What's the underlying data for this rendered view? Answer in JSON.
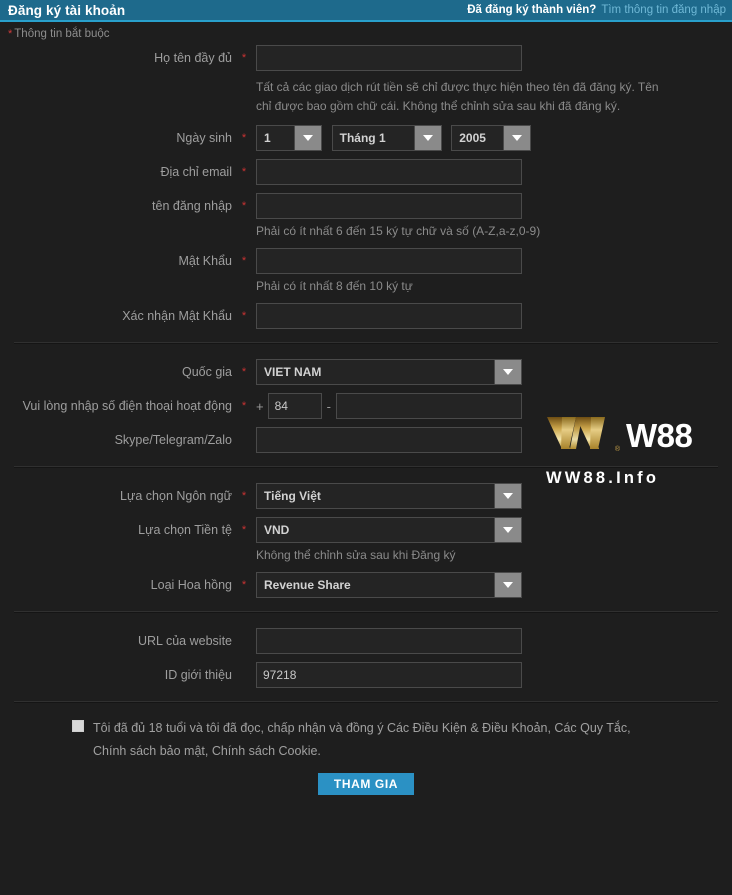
{
  "header": {
    "title": "Đăng ký tài khoản",
    "member_question": "Đã đăng ký thành viên?",
    "login_link": "Tìm thông tin đăng nhập"
  },
  "required_note": "Thông tin bắt buộc",
  "required_marker": "*",
  "form": {
    "fullname": {
      "label": "Họ tên đầy đủ",
      "value": "",
      "placeholder": "",
      "hint": "Tất cả các giao dịch rút tiền sẽ chỉ được thực hiện theo tên đã đăng ký. Tên chỉ được bao gồm chữ cái. Không thể chỉnh sửa sau khi đã đăng ký."
    },
    "dob": {
      "label": "Ngày sinh",
      "day": "1",
      "month": "Tháng 1",
      "year": "2005"
    },
    "email": {
      "label": "Địa chỉ email",
      "value": ""
    },
    "username": {
      "label": "tên đăng nhập",
      "value": "",
      "hint": "Phải có ít nhất 6 đến 15 ký tự chữ và số (A-Z,a-z,0-9)"
    },
    "password": {
      "label": "Mật Khẩu",
      "value": "",
      "hint": "Phải có ít nhất 8 đến 10 ký tự"
    },
    "confirm_password": {
      "label": "Xác nhận Mật Khẩu",
      "value": ""
    },
    "country": {
      "label": "Quốc gia",
      "value": "VIET NAM"
    },
    "phone": {
      "label": "Vui lòng nhập số điện thoại hoạt động",
      "plus": "+",
      "country_code": "84",
      "dash": "-",
      "number": ""
    },
    "messenger": {
      "label": "Skype/Telegram/Zalo",
      "value": ""
    },
    "language": {
      "label": "Lựa chọn Ngôn ngữ",
      "value": "Tiếng Việt"
    },
    "currency": {
      "label": "Lựa chọn Tiền tệ",
      "value": "VND",
      "hint": "Không thể chỉnh sửa sau khi Đăng ký"
    },
    "commission": {
      "label": "Loại Hoa hồng",
      "value": "Revenue Share"
    },
    "website_url": {
      "label": "URL của website",
      "value": ""
    },
    "referral_id": {
      "label": "ID giới thiệu",
      "value": "97218"
    }
  },
  "terms": {
    "text": "Tôi đã đủ 18 tuổi và tôi đã đọc, chấp nhận và đồng ý Các Điều Kiện & Điều Khoản, Các Quy Tắc, Chính sách bảo mật, Chính sách Cookie.",
    "checked": false
  },
  "submit_label": "THAM GIA",
  "logo": {
    "wordmark": "W88",
    "registered": "®",
    "subtitle": "WW88.Info"
  },
  "colors": {
    "header_bg": "#1e6a8c",
    "header_accent": "#29a0cc",
    "page_bg": "#1e1e1e",
    "input_bg": "#242424",
    "input_border": "#4a4a4a",
    "required_star": "#cc3333",
    "submit_bg": "#2b91c4",
    "link": "#6fb8d6",
    "logo_gold": "#c9a227"
  }
}
